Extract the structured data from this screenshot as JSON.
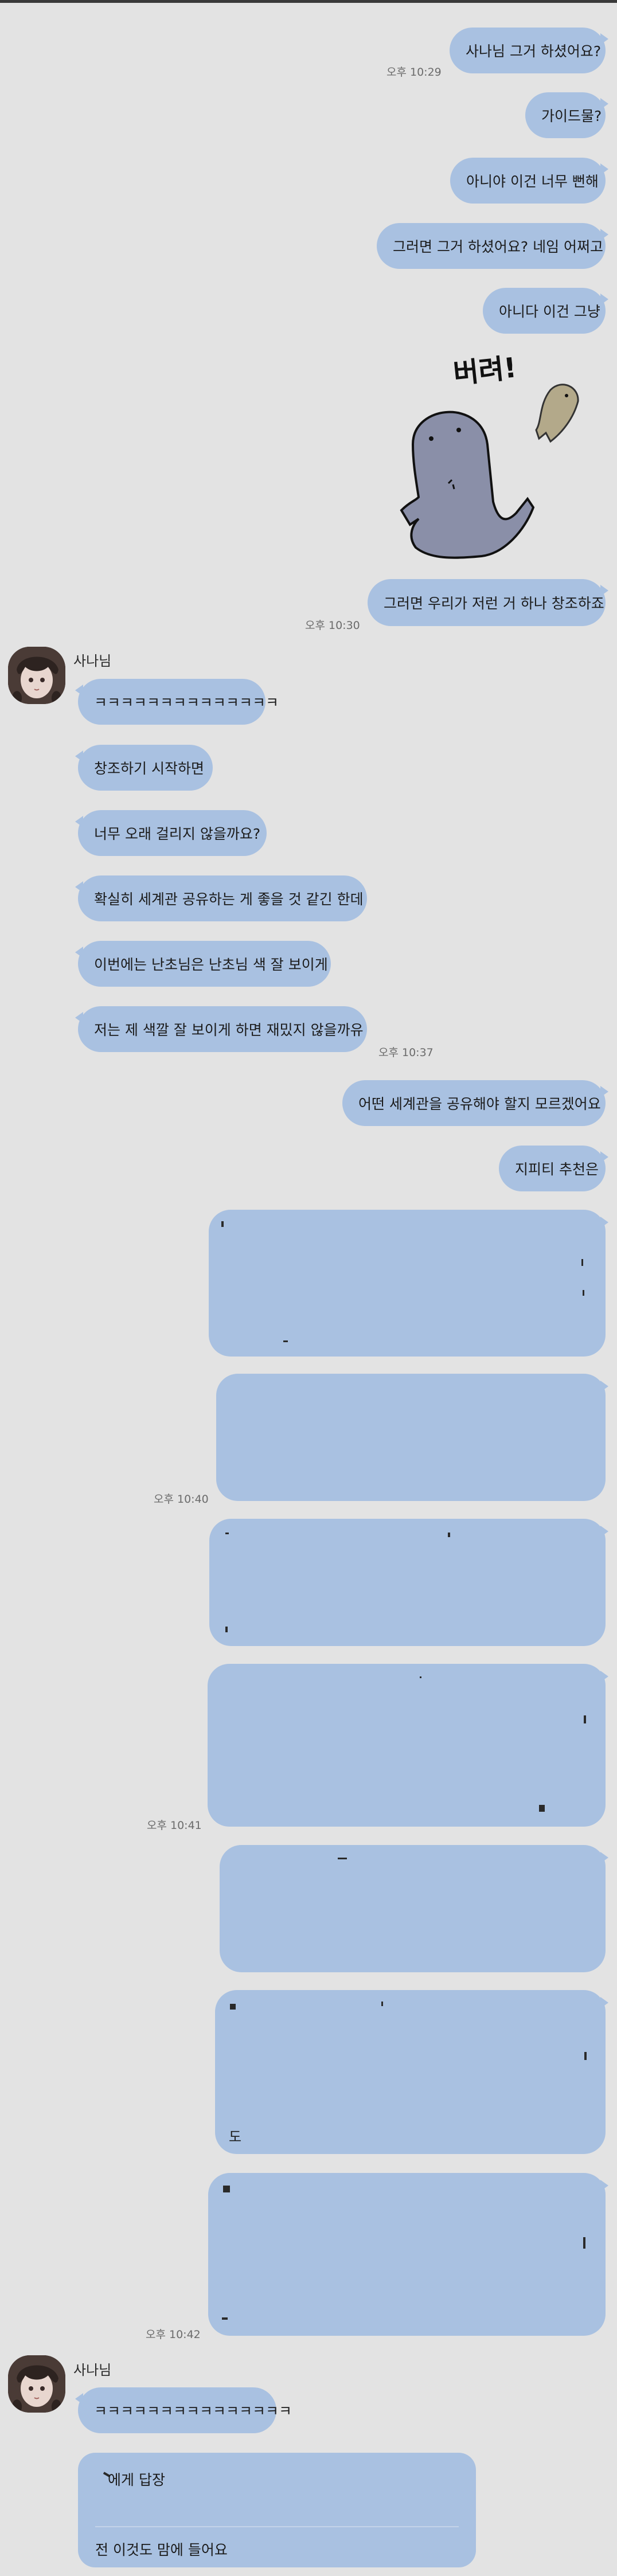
{
  "sender": {
    "name": "사나님"
  },
  "messages": {
    "m1": "사나님 그거 하셨어요?",
    "m2": "가이드물?",
    "m3": "아니야 이건 너무 뻔해",
    "m4": "그러면 그거 하셨어요? 네임 어쩌고",
    "m5": "아니다 이건 그냥",
    "sticker_text": "버려!",
    "m6": "그러면 우리가 저런 거 하나 창조하죠",
    "t1": "ㅋㅋㅋㅋㅋㅋㅋㅋㅋㅋㅋㅋㅋㅋ",
    "t2": "창조하기 시작하면",
    "t3": "너무 오래 걸리지 않을까요?",
    "t4": "확실히 세계관 공유하는 게 좋을 것 같긴 한데",
    "t5": "이번에는 난초님은 난초님 색 잘 보이게",
    "t6": "저는 제 색깔 잘 보이게 하면 재밌지 않을까유",
    "m7": "어떤 세계관을 공유해야 할지 모르겠어요",
    "m8": "지피티 추천은",
    "t7": "ㅋㅋㅋㅋㅋㅋㅋㅋㅋㅋㅋㅋㅋㅋㅋ",
    "reply_head": "에게 답장",
    "reply_body": "전 이것도 맘에 들어요",
    "marker_do": "도"
  },
  "timestamps": {
    "ts1": "오후 10:29",
    "ts2": "오후 10:30",
    "ts3": "오후 10:37",
    "ts4": "오후 10:40",
    "ts5": "오후 10:41",
    "ts6": "오후 10:42"
  },
  "colors": {
    "background": "#e3e3e3",
    "bubble": "#a9c1e1",
    "timestamp": "#6b6b6b"
  },
  "icons": {
    "avatar": "anime-character-avatar",
    "sticker": "cartoon-blob-throwing-fish"
  }
}
